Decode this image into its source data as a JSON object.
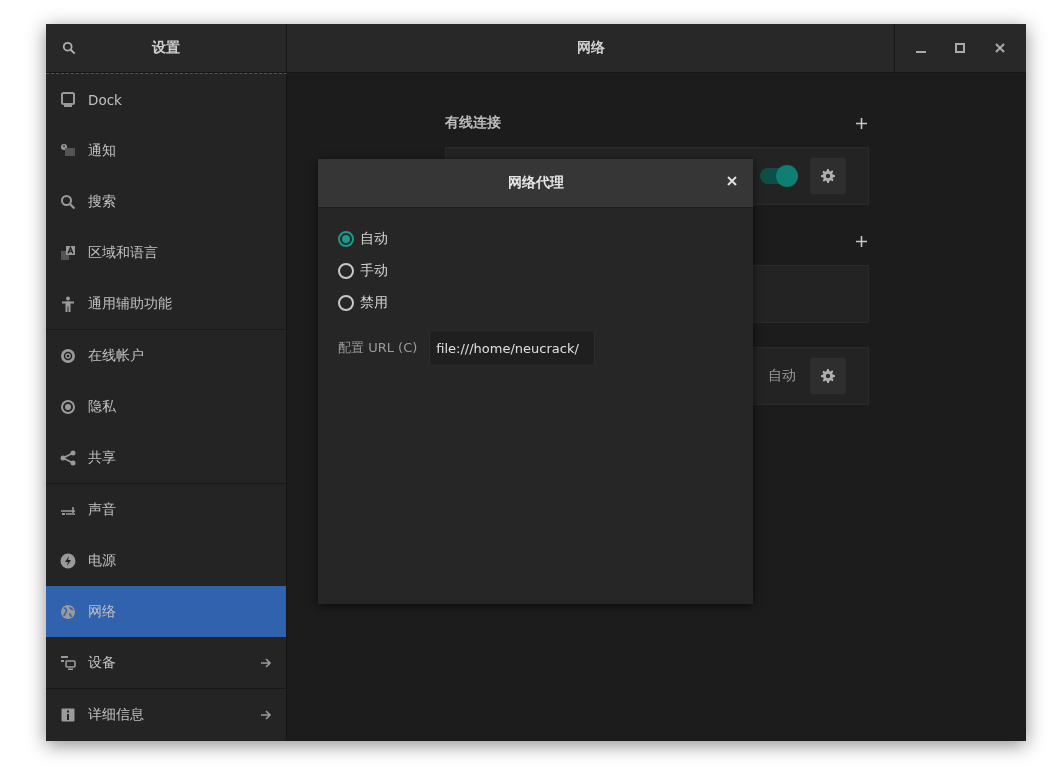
{
  "window": {
    "sidebar_title": "设置",
    "title": "网络"
  },
  "sidebar": {
    "groups": [
      {
        "items": [
          {
            "label": "Dock",
            "selected": false,
            "arrow": false
          },
          {
            "label": "通知",
            "selected": false,
            "arrow": false
          },
          {
            "label": "搜索",
            "selected": false,
            "arrow": false
          },
          {
            "label": "区域和语言",
            "selected": false,
            "arrow": false
          },
          {
            "label": "通用辅助功能",
            "selected": false,
            "arrow": false
          }
        ]
      },
      {
        "items": [
          {
            "label": "在线帐户",
            "selected": false,
            "arrow": false
          },
          {
            "label": "隐私",
            "selected": false,
            "arrow": false
          },
          {
            "label": "共享",
            "selected": false,
            "arrow": false
          }
        ]
      },
      {
        "items": [
          {
            "label": "声音",
            "selected": false,
            "arrow": false
          },
          {
            "label": "电源",
            "selected": false,
            "arrow": false
          },
          {
            "label": "网络",
            "selected": true,
            "arrow": false
          },
          {
            "label": "设备",
            "selected": false,
            "arrow": true
          }
        ]
      },
      {
        "items": [
          {
            "label": "详细信息",
            "selected": false,
            "arrow": true
          }
        ]
      }
    ]
  },
  "sections": [
    {
      "title": "有线连接",
      "add_button": true,
      "rows": [
        {
          "kind": "switch",
          "on": true
        }
      ]
    },
    {
      "add_button": true,
      "rows": [
        {
          "kind": "empty"
        }
      ]
    },
    {
      "rows": [
        {
          "kind": "value",
          "value": "自动"
        }
      ]
    }
  ],
  "dialog": {
    "title": "网络代理",
    "options": [
      {
        "label": "自动",
        "selected": true
      },
      {
        "label": "手动",
        "selected": false
      },
      {
        "label": "禁用",
        "selected": false
      }
    ],
    "url_label": "配置 URL (C)",
    "url_value": "file:///home/neucrack/"
  }
}
